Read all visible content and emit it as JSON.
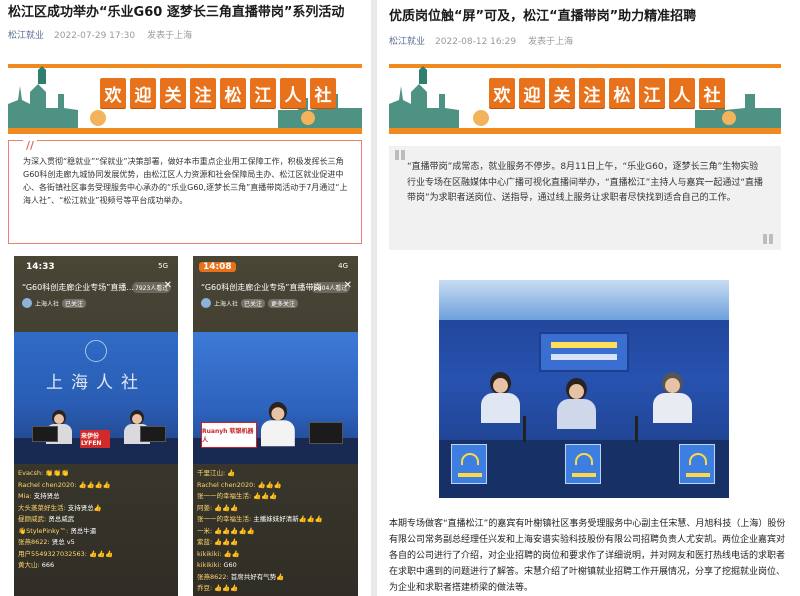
{
  "banner_chars": [
    "欢",
    "迎",
    "关",
    "注",
    "松",
    "江",
    "人",
    "社"
  ],
  "left": {
    "title": "松江区成功举办“乐业G60 逐梦长三角直播带岗”系列活动",
    "account": "松江就业",
    "date": "2022-07-29 17:30",
    "location": "发表于上海",
    "intro_mark": "//",
    "intro": "为深入贯彻“稳就业”“保就业”决策部署，做好本市重点企业用工保障工作，积极发挥长三角G60科创走廊九城协同发展优势，由松江区人力资源和社会保障局主办、松江区就业促进中心、各街镇社区事务受理服务中心承办的“乐业G60,逐梦长三角”直播带岗活动于7月通过“上海人社”、“松江就业”视频号等平台成功举办。",
    "phone1": {
      "time": "14:33",
      "network": "5G",
      "live_title": "“G60科创走廊企业专场”直播...",
      "viewers": "7923人看过",
      "account": "上海人社",
      "badge": "已关注",
      "backdrop": "上海人社",
      "sponsor": "来伊份 LYFEN",
      "comments": [
        {
          "name": "Evacsh:",
          "text": "👏👏👏"
        },
        {
          "name": "Rachel chen2020:",
          "text": "👍👍👍👍"
        },
        {
          "name": "Mia:",
          "text": "支持贤总"
        },
        {
          "name": "大头蒸菜好生活:",
          "text": "支持贤总👍"
        },
        {
          "name": "昼颜威武:",
          "text": "贤总威武"
        },
        {
          "name": "👋StylePinky™:",
          "text": "贤总牛逼"
        },
        {
          "name": "张燕8622:",
          "text": "贤总 v5"
        },
        {
          "name": "用户5549327032563:",
          "text": "👍👍👍"
        },
        {
          "name": "黄大山:",
          "text": "666"
        }
      ]
    },
    "phone2": {
      "time": "14:08",
      "network": "4G",
      "live_title": "“G60科创走廊企业专场”直播带岗",
      "viewers": "6804人看过",
      "account": "上海人社",
      "badge": "已关注",
      "badge2": "更多关注",
      "sponsor": "Ruanyh 软银机器人",
      "comments": [
        {
          "name": "千里江山:",
          "text": "👍"
        },
        {
          "name": "Rachel chen2020:",
          "text": "👍👍👍"
        },
        {
          "name": "张一一的幸福生活:",
          "text": "👍👍👍"
        },
        {
          "name": "阿姜:",
          "text": "👍👍👍"
        },
        {
          "name": "张一一的幸福生活:",
          "text": "主播妹妹好清新👍👍👍"
        },
        {
          "name": "一米:",
          "text": "👍👍👍👍👍"
        },
        {
          "name": "紫蓝:",
          "text": "👍👍👍"
        },
        {
          "name": "kikikiki:",
          "text": "👍👍"
        },
        {
          "name": "kikikiki:",
          "text": "G60"
        },
        {
          "name": "张燕8622:",
          "text": "首席共好有气势👍"
        },
        {
          "name": "乔豆:",
          "text": "👍👍👍"
        }
      ]
    }
  },
  "right": {
    "title": "优质岗位触“屏”可及，松江“直播带岗”助力精准招聘",
    "account": "松江就业",
    "date": "2022-08-12 16:29",
    "location": "发表于上海",
    "intro": "“直播带岗”成常态，就业服务不停步。8月11日上午，“乐业G60，逐梦长三角”生物实验行业专场在区融媒体中心广播可视化直播间举办，“直播松江”主持人与嘉宾一起通过“直播带岗”为求职者送岗位、送指导，通过线上服务让求职者尽快找到适合自己的工作。",
    "body": "本期专场做客“直播松江”的嘉宾有叶榭镇社区事务受理服务中心副主任宋慧、月旭科技（上海）股份有限公司常务副总经理任兴发和上海安谱实验科技股份有限公司招聘负责人尤安凯。两位企业嘉宾对各自的公司进行了介绍，对企业招聘的岗位和要求作了详细说明，并对网友和医打热线电话的求职者在求职中遇到的问题进行了解答。宋慧介绍了叶榭镇就业招聘工作开展情况，分享了挖掘就业岗位、为企业和求职者搭建桥梁的做法等。"
  },
  "colors": {
    "accent": "#e8711b",
    "account_link": "#5a6e93",
    "box_border": "#e6836f",
    "studio_blue": "#2752b0"
  }
}
